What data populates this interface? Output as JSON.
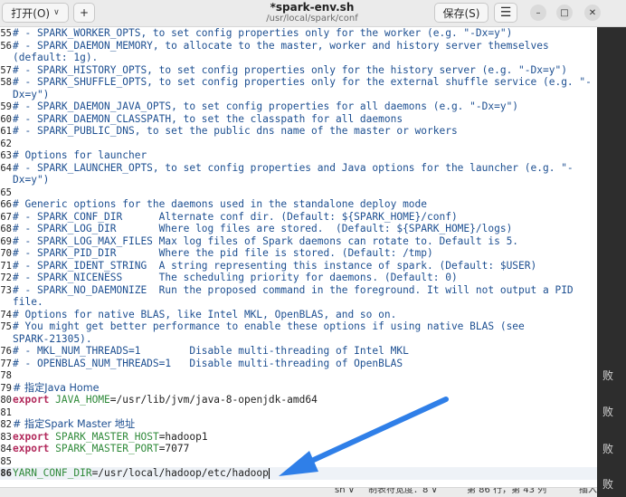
{
  "header": {
    "open_label": "打开(O)",
    "newtab_symbol": "+",
    "title": "*spark-env.sh",
    "path": "/usr/local/spark/conf",
    "save_label": "保存(S)",
    "menu_symbol": "☰",
    "minimize_symbol": "–",
    "maximize_symbol": "□",
    "close_symbol": "✕"
  },
  "editor": {
    "lines": [
      {
        "ln": "55",
        "text": "# - SPARK_WORKER_OPTS, to set config properties only for the worker (e.g. \"-Dx=y\")"
      },
      {
        "ln": "56",
        "text": "# - SPARK_DAEMON_MEMORY, to allocate to the master, worker and history server themselves"
      },
      {
        "ln": "",
        "text": "(default: 1g)."
      },
      {
        "ln": "57",
        "text": "# - SPARK_HISTORY_OPTS, to set config properties only for the history server (e.g. \"-Dx=y\")"
      },
      {
        "ln": "58",
        "text": "# - SPARK_SHUFFLE_OPTS, to set config properties only for the external shuffle service (e.g. \"-"
      },
      {
        "ln": "",
        "text": "Dx=y\")"
      },
      {
        "ln": "59",
        "text": "# - SPARK_DAEMON_JAVA_OPTS, to set config properties for all daemons (e.g. \"-Dx=y\")"
      },
      {
        "ln": "60",
        "text": "# - SPARK_DAEMON_CLASSPATH, to set the classpath for all daemons"
      },
      {
        "ln": "61",
        "text": "# - SPARK_PUBLIC_DNS, to set the public dns name of the master or workers"
      },
      {
        "ln": "62",
        "text": ""
      },
      {
        "ln": "63",
        "text": "# Options for launcher"
      },
      {
        "ln": "64",
        "text": "# - SPARK_LAUNCHER_OPTS, to set config properties and Java options for the launcher (e.g. \"-"
      },
      {
        "ln": "",
        "text": "Dx=y\")"
      },
      {
        "ln": "65",
        "text": ""
      },
      {
        "ln": "66",
        "text": "# Generic options for the daemons used in the standalone deploy mode"
      },
      {
        "ln": "67",
        "text": "# - SPARK_CONF_DIR      Alternate conf dir. (Default: ${SPARK_HOME}/conf)"
      },
      {
        "ln": "68",
        "text": "# - SPARK_LOG_DIR       Where log files are stored.  (Default: ${SPARK_HOME}/logs)"
      },
      {
        "ln": "69",
        "text": "# - SPARK_LOG_MAX_FILES Max log files of Spark daemons can rotate to. Default is 5."
      },
      {
        "ln": "70",
        "text": "# - SPARK_PID_DIR       Where the pid file is stored. (Default: /tmp)"
      },
      {
        "ln": "71",
        "text": "# - SPARK_IDENT_STRING  A string representing this instance of spark. (Default: $USER)"
      },
      {
        "ln": "72",
        "text": "# - SPARK_NICENESS      The scheduling priority for daemons. (Default: 0)"
      },
      {
        "ln": "73",
        "text": "# - SPARK_NO_DAEMONIZE  Run the proposed command in the foreground. It will not output a PID"
      },
      {
        "ln": "",
        "text": "file."
      },
      {
        "ln": "74",
        "text": "# Options for native BLAS, like Intel MKL, OpenBLAS, and so on."
      },
      {
        "ln": "75",
        "text": "# You might get better performance to enable these options if using native BLAS (see"
      },
      {
        "ln": "",
        "text": "SPARK-21305)."
      },
      {
        "ln": "76",
        "text": "# - MKL_NUM_THREADS=1        Disable multi-threading of Intel MKL"
      },
      {
        "ln": "77",
        "text": "# - OPENBLAS_NUM_THREADS=1   Disable multi-threading of OpenBLAS"
      },
      {
        "ln": "78",
        "text": ""
      },
      {
        "ln": "79",
        "text": "# 指定Java Home"
      },
      {
        "ln": "80",
        "kw": "export",
        "var": "JAVA_HOME",
        "val": "=/usr/lib/jvm/java-8-openjdk-amd64"
      },
      {
        "ln": "81",
        "text": ""
      },
      {
        "ln": "82",
        "text": "# 指定Spark Master 地址"
      },
      {
        "ln": "83",
        "kw": "export",
        "var": "SPARK_MASTER_HOST",
        "val": "=hadoop1"
      },
      {
        "ln": "84",
        "kw": "export",
        "var": "SPARK_MASTER_PORT",
        "val": "=7077"
      },
      {
        "ln": "85",
        "text": ""
      },
      {
        "ln": "86",
        "var": "YARN_CONF_DIR",
        "val": "=/usr/local/hadoop/etc/hadoop",
        "current": true
      }
    ]
  },
  "side_texts": [
    "败",
    "败",
    "败",
    "败"
  ],
  "status": {
    "lang": "sh ∨",
    "tab_width": "制表符宽度：8 ∨",
    "position": "第 86 行，第 43 列",
    "mode": "插入"
  },
  "colors": {
    "comment": "#1d4f91",
    "keyword": "#b22a5c",
    "variable": "#2f8a3a",
    "arrow": "#2f7fe8"
  }
}
